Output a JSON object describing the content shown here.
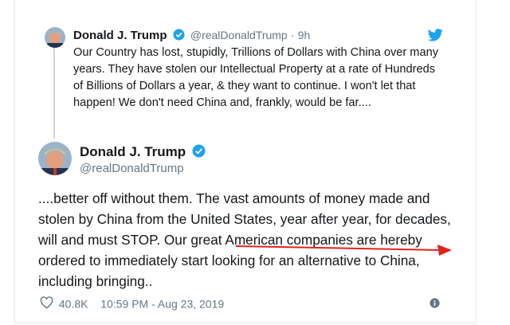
{
  "quoted": {
    "name": "Donald J. Trump",
    "handle": "@realDonaldTrump",
    "separator": "·",
    "time": "9h",
    "text": "Our Country has lost, stupidly, Trillions of Dollars with China over many years. They have stolen our Intellectual Property at a rate of Hundreds of Billions of Dollars a year, & they want to continue. I won't let that happen! We don't need China and, frankly, would be far...."
  },
  "main": {
    "name": "Donald J. Trump",
    "handle": "@realDonaldTrump",
    "text": "....better off without them. The vast amounts of money made and stolen by China from the United States, year after year, for decades, will and must STOP. Our great American companies are hereby ordered to immediately start looking for an alternative to China, including bringing.."
  },
  "footer": {
    "likes": "40.8K",
    "timestamp": "10:59 PM - Aug 23, 2019"
  },
  "icons": {
    "verified": "verified-badge-icon",
    "twitter": "twitter-bird-icon",
    "like": "heart-icon",
    "info": "info-icon"
  },
  "colors": {
    "twitter_blue": "#1da1f2",
    "secondary_text": "#657786",
    "annotation_red": "#e0241b"
  }
}
